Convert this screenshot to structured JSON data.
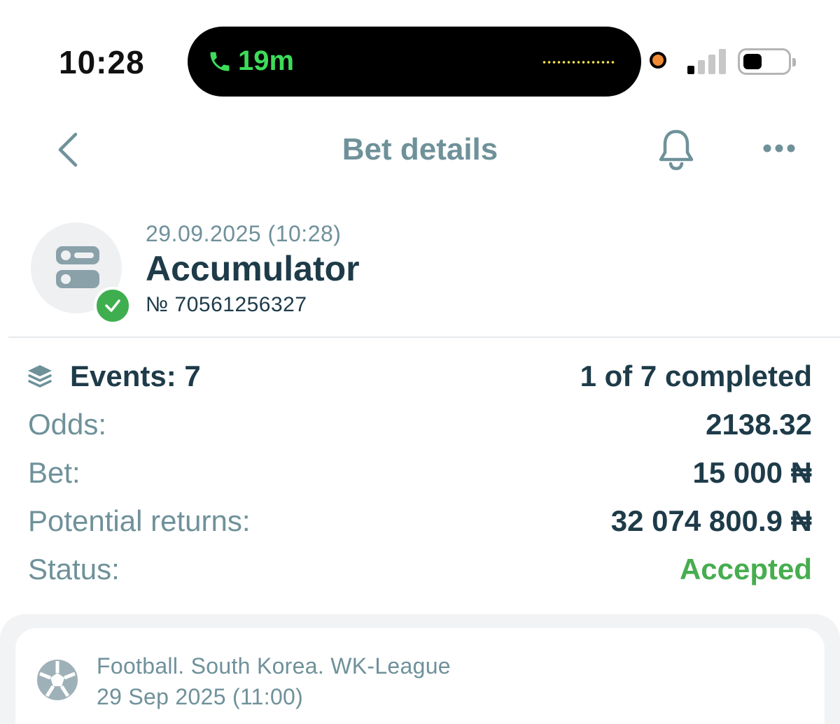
{
  "status_bar": {
    "time": "10:28",
    "call_duration": "19m"
  },
  "nav": {
    "title": "Bet details"
  },
  "bet": {
    "date": "29.09.2025 (10:28)",
    "type": "Accumulator",
    "number": "№ 70561256327"
  },
  "details": {
    "events_label": "Events: 7",
    "events_progress": "1 of 7 completed",
    "odds_label": "Odds:",
    "odds_value": "2138.32",
    "bet_label": "Bet:",
    "bet_value": "15 000 ₦",
    "returns_label": "Potential returns:",
    "returns_value": "32 074 800.9 ₦",
    "status_label": "Status:",
    "status_value": "Accepted"
  },
  "event_card": {
    "league": "Football. South Korea. WK-League",
    "date": "29 Sep 2025 (11:00)"
  },
  "colors": {
    "accent_text": "#6f919a",
    "primary_text": "#1e3b49",
    "success": "#47ad4f",
    "call_green": "#3ddc5a"
  },
  "icons": [
    "phone-icon",
    "back-chevron-icon",
    "bell-icon",
    "more-icon",
    "accumulator-icon",
    "check-icon",
    "events-stack-icon",
    "football-icon"
  ]
}
